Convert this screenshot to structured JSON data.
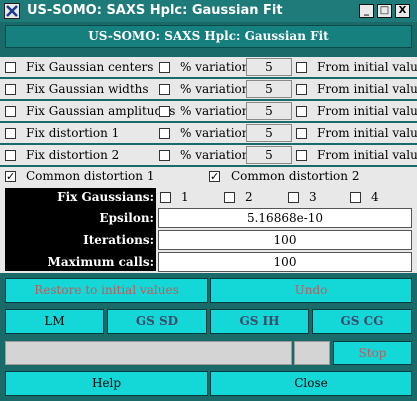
{
  "window": {
    "title": "US-SOMO: SAXS Hplc: Gaussian Fit",
    "controls": [
      "_",
      "□",
      "X"
    ]
  },
  "banner": "US-SOMO: SAXS Hplc: Gaussian Fit",
  "fix_rows": [
    {
      "label": "Fix Gaussian centers",
      "pct_label": "% variation",
      "value": "5",
      "init_label": "From initial value"
    },
    {
      "label": "Fix Gaussian widths",
      "pct_label": "% variation",
      "value": "5",
      "init_label": "From initial value"
    },
    {
      "label": "Fix Gaussian amplitudes",
      "pct_label": "% variation",
      "value": "5",
      "init_label": "From initial value"
    },
    {
      "label": "Fix distortion 1",
      "pct_label": "% variation",
      "value": "5",
      "init_label": "From initial value"
    },
    {
      "label": "Fix distortion 2",
      "pct_label": "% variation",
      "value": "5",
      "init_label": "From initial value"
    }
  ],
  "common": {
    "d1": {
      "label": "Common distortion 1",
      "checked": true
    },
    "d2": {
      "label": "Common distortion 2",
      "checked": true
    },
    "check_mark": "✓"
  },
  "params": {
    "fix_gaussians_label": "Fix Gaussians:",
    "gaussians": [
      "1",
      "2",
      "3",
      "4"
    ],
    "epsilon_label": "Epsilon:",
    "epsilon_value": "5.16868e-10",
    "iterations_label": "Iterations:",
    "iterations_value": "100",
    "max_calls_label": "Maximum calls:",
    "max_calls_value": "100"
  },
  "buttons": {
    "restore": "Restore to initial values",
    "undo": "Undo",
    "lm": "LM",
    "gs_sd": "GS SD",
    "gs_ih": "GS IH",
    "gs_cg": "GS CG",
    "stop": "Stop",
    "help": "Help",
    "close": "Close"
  },
  "colors": {
    "accent": "#14d7d7",
    "titlebar": "#1f7a7a",
    "panel": "#e8e8e8"
  }
}
